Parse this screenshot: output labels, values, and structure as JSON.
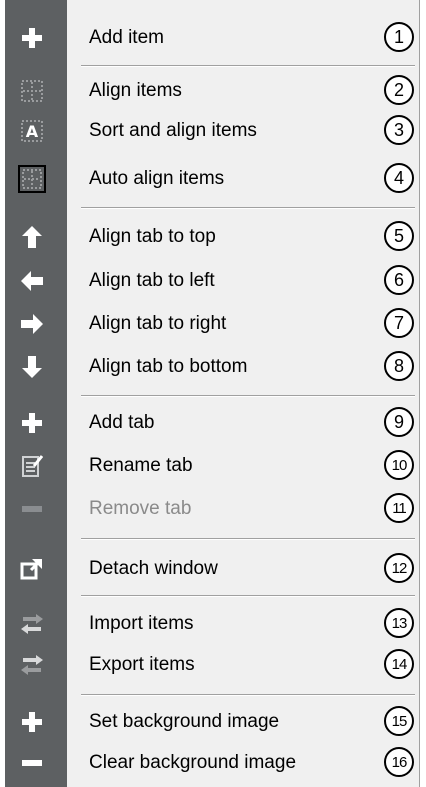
{
  "menu": {
    "items": [
      {
        "label": "Add item",
        "number": "1",
        "icon": "plus-icon"
      },
      {
        "label": "Align items",
        "number": "2",
        "icon": "grid-dotted-icon"
      },
      {
        "label": "Sort and align items",
        "number": "3",
        "icon": "sort-a-icon"
      },
      {
        "label": "Auto align items",
        "number": "4",
        "icon": "grid-framed-icon"
      },
      {
        "label": "Align tab to top",
        "number": "5",
        "icon": "arrow-up-icon"
      },
      {
        "label": "Align tab to left",
        "number": "6",
        "icon": "arrow-left-icon"
      },
      {
        "label": "Align tab to right",
        "number": "7",
        "icon": "arrow-right-icon"
      },
      {
        "label": "Align tab to bottom",
        "number": "8",
        "icon": "arrow-down-icon"
      },
      {
        "label": "Add tab",
        "number": "9",
        "icon": "plus-icon"
      },
      {
        "label": "Rename tab",
        "number": "10",
        "icon": "rename-icon"
      },
      {
        "label": "Remove tab",
        "number": "11",
        "icon": "minus-icon",
        "disabled": true
      },
      {
        "label": "Detach window",
        "number": "12",
        "icon": "detach-icon"
      },
      {
        "label": "Import items",
        "number": "13",
        "icon": "swap-arrows-icon"
      },
      {
        "label": "Export items",
        "number": "14",
        "icon": "swap-arrows-icon"
      },
      {
        "label": "Set background image",
        "number": "15",
        "icon": "plus-icon"
      },
      {
        "label": "Clear background image",
        "number": "16",
        "icon": "minus-icon"
      }
    ]
  },
  "colors": {
    "gutter": "#5d6062",
    "menu_background": "#f0f0f0",
    "disabled_text": "#8a8a8a"
  }
}
